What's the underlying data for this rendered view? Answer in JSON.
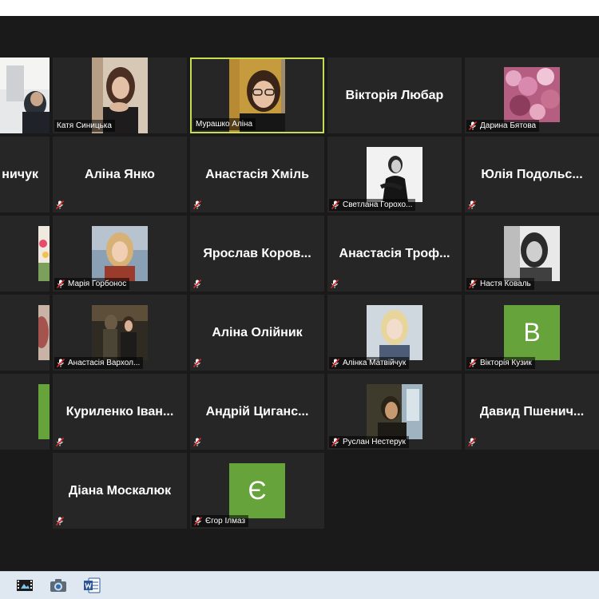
{
  "colors": {
    "active_border": "#c8dc52",
    "avatar_green": "#66a33a",
    "tile": "#262626",
    "background": "#1a1a1a"
  },
  "participants": {
    "r1c2": {
      "name": "Катя Синицька"
    },
    "r1c3": {
      "name": "Мурашко Аліна"
    },
    "r1c4": {
      "name": "Вікторія Любар"
    },
    "r1c5": {
      "name": "Дарина Бятова"
    },
    "r2c1": {
      "name": "ничук"
    },
    "r2c2": {
      "name": "Аліна Янко"
    },
    "r2c3": {
      "name": "Анастасія Хміль"
    },
    "r2c4": {
      "name": "Светлана Горохо..."
    },
    "r2c5": {
      "name": "Юлія Подольс..."
    },
    "r3c2": {
      "name": "Марія Горбонос"
    },
    "r3c3": {
      "name": "Ярослав Коров..."
    },
    "r3c4": {
      "name": "Анастасія Троф..."
    },
    "r3c5": {
      "name": "Настя Коваль"
    },
    "r4c2": {
      "name": "Анастасія Вархол..."
    },
    "r4c3": {
      "name": "Аліна Олійник"
    },
    "r4c4": {
      "name": "Алінка Матвійчук"
    },
    "r4c5": {
      "name": "Вікторія Кузик",
      "initial": "B"
    },
    "r5c2": {
      "name": "Куриленко Іван..."
    },
    "r5c3": {
      "name": "Андрій Циганс..."
    },
    "r5c4": {
      "name": "Руслан Нестерук"
    },
    "r5c5": {
      "name": "Давид Пшенич..."
    },
    "r6c2": {
      "name": "Діана Москалюк"
    },
    "r6c3": {
      "name": "Єгор Ілмаз",
      "initial": "Є"
    }
  },
  "taskbar": {
    "icons": [
      "film-icon",
      "camera-icon",
      "word-icon"
    ]
  }
}
